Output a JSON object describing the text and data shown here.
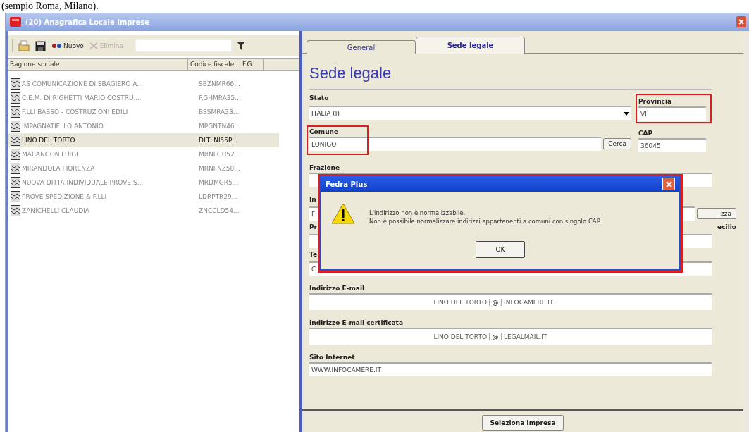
{
  "caption": "(sempio Roma, Milano).",
  "window": {
    "title": "(20) Anagrafica Locale Imprese"
  },
  "toolbar": {
    "new_label": "Nuovo",
    "delete_label": "Elimina",
    "delete_disabled": true
  },
  "table": {
    "columns": [
      "Ragione sociale",
      "Codice fiscale",
      "F.G."
    ],
    "rows": [
      {
        "name": "AS COMUNICAZIONE DI SBAGIERO A...",
        "code": "SBZNMR66...",
        "selected": false
      },
      {
        "name": "C.E.M. DI RIGHETTI MARIO COSTRU...",
        "code": "RGHMRA35...",
        "selected": false
      },
      {
        "name": "F.LLI BASSO - COSTRUZIONI EDILI",
        "code": "BSSMRA33...",
        "selected": false
      },
      {
        "name": "IMPAGNATIELLO ANTONIO",
        "code": "MPGNTN46...",
        "selected": false
      },
      {
        "name": "LINO DEL TORTO",
        "code": "DLTLNI55P...",
        "selected": true
      },
      {
        "name": "MARANGON LUIGI",
        "code": "MRNLGU52...",
        "selected": false
      },
      {
        "name": "MIRANDOLA FIORENZA",
        "code": "MRNFNZ58...",
        "selected": false
      },
      {
        "name": "NUOVA DITTA INDIVIDUALE PROVE S...",
        "code": "MRDMGR5...",
        "selected": false
      },
      {
        "name": "PROVE SPEDIZIONE & F.LLI",
        "code": "LDRPTR29...",
        "selected": false
      },
      {
        "name": "ZANICHELLI CLAUDIA",
        "code": "ZNCCLD54...",
        "selected": false
      }
    ]
  },
  "tabs": [
    {
      "label": "General",
      "selected": false
    },
    {
      "label": "Sede legale",
      "selected": true
    }
  ],
  "form": {
    "heading": "Sede legale",
    "stato": {
      "label": "Stato",
      "value": "ITALIA (I)"
    },
    "provincia": {
      "label": "Provincia",
      "value": "VI",
      "highlighted": true
    },
    "comune": {
      "label": "Comune",
      "value": "LONIGO",
      "highlighted": true
    },
    "cerca_button": "Cerca",
    "cap": {
      "label": "CAP",
      "value": "36045"
    },
    "frazione": {
      "label": "Frazione"
    },
    "covered": {
      "indirizzo_label": "In",
      "indirizzo_value": "F",
      "normalize_button": "zza",
      "label_2": "Pr",
      "label_3": "ecilio",
      "label_4": "Te",
      "value_4": "C"
    },
    "email": {
      "label": "Indirizzo E-mail",
      "user": "LINO DEL TORTO",
      "at": "@",
      "domain": "INFOCAMERE.IT"
    },
    "pec": {
      "label": "Indirizzo E-mail certificata",
      "user": "LINO DEL TORTO",
      "at": "@",
      "domain": "LEGALMAIL.IT"
    },
    "sito": {
      "label": "Sito Internet",
      "value": "WWW.INFOCAMERE.IT"
    },
    "select_button": "Seleziona Impresa"
  },
  "dialog": {
    "title": "Fedra Plus",
    "lines": [
      "L'indirizzo non è normalizzabile.",
      "Non è possibile normalizzare indirizzi appartenenti a comuni con singolo CAP."
    ],
    "ok": "OK",
    "highlighted": true
  }
}
